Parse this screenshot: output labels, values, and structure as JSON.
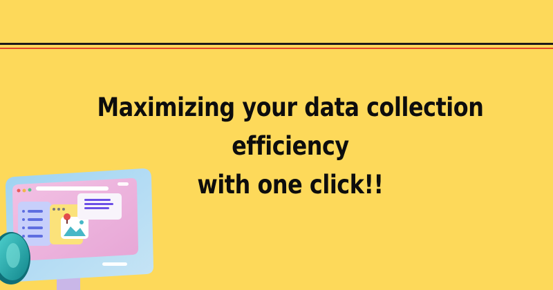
{
  "headline": {
    "line1": "Maximizing your data collection efficiency",
    "line2": "with one click!!"
  },
  "colors": {
    "background": "#FDD95A",
    "rule_dark": "#1c1a1a",
    "rule_red": "#E2482A",
    "text": "#0d0d0d"
  },
  "illustration": {
    "icons": [
      "monitor-icon",
      "browser-window-icon",
      "image-card-icon",
      "location-pin-icon",
      "menu-panel-icon"
    ]
  }
}
